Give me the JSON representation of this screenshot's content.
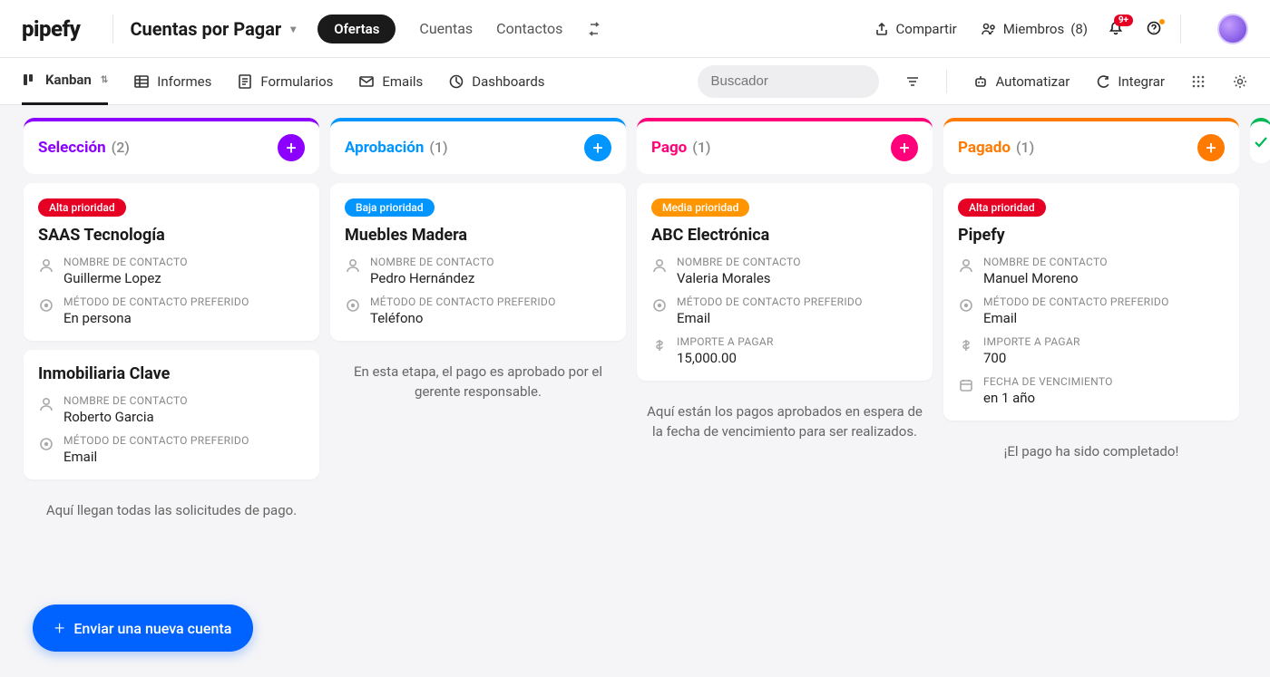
{
  "header": {
    "logo": "pipefy",
    "workspace": "Cuentas por Pagar",
    "active_pill": "Ofertas",
    "nav": [
      "Cuentas",
      "Contactos"
    ],
    "share": "Compartir",
    "members_label": "Miembros",
    "members_count": "(8)",
    "notif_badge": "9+"
  },
  "toolbar": {
    "tabs": [
      {
        "label": "Kanban",
        "active": true
      },
      {
        "label": "Informes"
      },
      {
        "label": "Formularios"
      },
      {
        "label": "Emails"
      },
      {
        "label": "Dashboards"
      }
    ],
    "search_placeholder": "Buscador",
    "automate": "Automatizar",
    "integrate": "Integrar"
  },
  "columns": [
    {
      "title": "Selección",
      "count": "(2)",
      "color": "#8b00ff",
      "title_color": "#8b00ff",
      "cards": [
        {
          "priority": "Alta prioridad",
          "priority_class": "alta",
          "title": "SAAS Tecnología",
          "fields": [
            {
              "icon": "user",
              "label": "NOMBRE DE CONTACTO",
              "value": "Guillerme Lopez"
            },
            {
              "icon": "target",
              "label": "MÉTODO DE CONTACTO PREFERIDO",
              "value": "En persona"
            }
          ]
        },
        {
          "title": "Inmobiliaria Clave",
          "fields": [
            {
              "icon": "user",
              "label": "NOMBRE DE CONTACTO",
              "value": "Roberto Garcia"
            },
            {
              "icon": "target",
              "label": "MÉTODO DE CONTACTO PREFERIDO",
              "value": "Email"
            }
          ]
        }
      ],
      "msg": "Aquí llegan todas las solicitudes de pago."
    },
    {
      "title": "Aprobación",
      "count": "(1)",
      "color": "#0095ff",
      "title_color": "#0095ff",
      "cards": [
        {
          "priority": "Baja prioridad",
          "priority_class": "baja",
          "title": "Muebles Madera",
          "fields": [
            {
              "icon": "user",
              "label": "NOMBRE DE CONTACTO",
              "value": "Pedro Hernández"
            },
            {
              "icon": "target",
              "label": "MÉTODO DE CONTACTO PREFERIDO",
              "value": "Teléfono"
            }
          ]
        }
      ],
      "msg": "En esta etapa, el pago es aprobado por el gerente responsable."
    },
    {
      "title": "Pago",
      "count": "(1)",
      "color": "#ff007a",
      "title_color": "#ff007a",
      "cards": [
        {
          "priority": "Media prioridad",
          "priority_class": "media",
          "title": "ABC Electrónica",
          "fields": [
            {
              "icon": "user",
              "label": "NOMBRE DE CONTACTO",
              "value": "Valeria Morales"
            },
            {
              "icon": "target",
              "label": "MÉTODO DE CONTACTO PREFERIDO",
              "value": "Email"
            },
            {
              "icon": "dollar",
              "label": "IMPORTE A PAGAR",
              "value": "15,000.00"
            }
          ]
        }
      ],
      "msg": "Aquí están los pagos aprobados en espera de la fecha de vencimiento para ser realizados."
    },
    {
      "title": "Pagado",
      "count": "(1)",
      "color": "#ff7a00",
      "title_color": "#ff7a00",
      "cards": [
        {
          "priority": "Alta prioridad",
          "priority_class": "alta",
          "title": "Pipefy",
          "fields": [
            {
              "icon": "user",
              "label": "NOMBRE DE CONTACTO",
              "value": "Manuel Moreno"
            },
            {
              "icon": "target",
              "label": "MÉTODO DE CONTACTO PREFERIDO",
              "value": "Email"
            },
            {
              "icon": "dollar",
              "label": "IMPORTE A PAGAR",
              "value": "700"
            },
            {
              "icon": "calendar",
              "label": "FECHA DE VENCIMIENTO",
              "value": "en 1 año"
            }
          ]
        }
      ],
      "msg": "¡El pago ha sido completado!"
    }
  ],
  "fab": "Enviar una nueva cuenta"
}
